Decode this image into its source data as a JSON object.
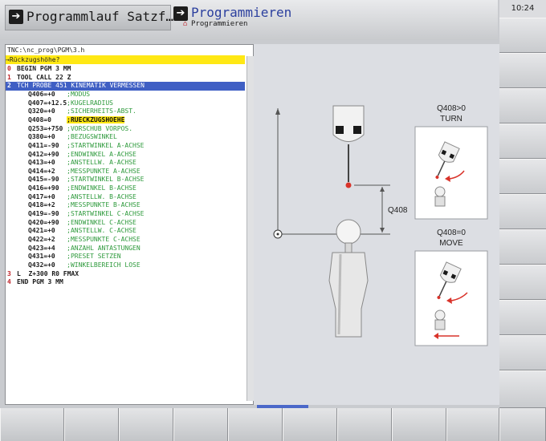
{
  "header": {
    "modeA_label": "Programmlauf Satzf…",
    "modeB_title": "Programmieren",
    "modeB_subtitle": "Programmieren",
    "clock": "10:24"
  },
  "program": {
    "path": "TNC:\\nc_prog\\PGM\\3.h",
    "prompt": "→Rückzugshöhe?",
    "lines": [
      {
        "num": "0",
        "code": "BEGIN PGM 3 MM",
        "comment": ""
      },
      {
        "num": "1",
        "code": "TOOL CALL 22 Z",
        "comment": ""
      },
      {
        "num": "2",
        "code": "TCH PROBE 451 KINEMATIK VERMESSEN",
        "comment": ""
      },
      {
        "num": "",
        "code": "Q406=+0   ",
        "comment": ";MODUS"
      },
      {
        "num": "",
        "code": "Q407=+12.5",
        "comment": ";KUGELRADIUS"
      },
      {
        "num": "",
        "code": "Q320=+0   ",
        "comment": ";SICHERHEITS-ABST."
      },
      {
        "num": "",
        "code": "Q408=0    ",
        "comment": ";RUECKZUGSHOEHE"
      },
      {
        "num": "",
        "code": "Q253=+750 ",
        "comment": ";VORSCHUB VORPOS."
      },
      {
        "num": "",
        "code": "Q380=+0   ",
        "comment": ";BEZUGSWINKEL"
      },
      {
        "num": "",
        "code": "Q411=-90  ",
        "comment": ";STARTWINKEL A-ACHSE"
      },
      {
        "num": "",
        "code": "Q412=+90  ",
        "comment": ";ENDWINKEL A-ACHSE"
      },
      {
        "num": "",
        "code": "Q413=+0   ",
        "comment": ";ANSTELLW. A-ACHSE"
      },
      {
        "num": "",
        "code": "Q414=+2   ",
        "comment": ";MESSPUNKTE A-ACHSE"
      },
      {
        "num": "",
        "code": "Q415=-90  ",
        "comment": ";STARTWINKEL B-ACHSE"
      },
      {
        "num": "",
        "code": "Q416=+90  ",
        "comment": ";ENDWINKEL B-ACHSE"
      },
      {
        "num": "",
        "code": "Q417=+0   ",
        "comment": ";ANSTELLW. B-ACHSE"
      },
      {
        "num": "",
        "code": "Q418=+2   ",
        "comment": ";MESSPUNKTE B-ACHSE"
      },
      {
        "num": "",
        "code": "Q419=-90  ",
        "comment": ";STARTWINKEL C-ACHSE"
      },
      {
        "num": "",
        "code": "Q420=+90  ",
        "comment": ";ENDWINKEL C-ACHSE"
      },
      {
        "num": "",
        "code": "Q421=+0   ",
        "comment": ";ANSTELLW. C-ACHSE"
      },
      {
        "num": "",
        "code": "Q422=+2   ",
        "comment": ";MESSPUNKTE C-ACHSE"
      },
      {
        "num": "",
        "code": "Q423=+4   ",
        "comment": ";ANZAHL ANTASTUNGEN"
      },
      {
        "num": "",
        "code": "Q431=+0   ",
        "comment": ";PRESET SETZEN"
      },
      {
        "num": "",
        "code": "Q432=+0   ",
        "comment": ";WINKELBEREICH LOSE"
      },
      {
        "num": "3",
        "code": "L  Z+300 R0 FMAX",
        "comment": ""
      },
      {
        "num": "4",
        "code": "END PGM 3 MM",
        "comment": ""
      }
    ]
  },
  "graphic": {
    "q408_label": "Q408",
    "turn_title": "Q408>0",
    "turn_sub": "TURN",
    "move_title": "Q408=0",
    "move_sub": "MOVE",
    "accent_red": "#d9332a",
    "active_blue": "#3f5fc4",
    "prompt_yellow": "#ffe814"
  }
}
